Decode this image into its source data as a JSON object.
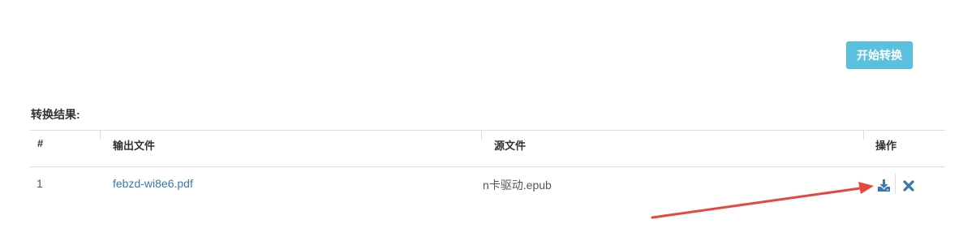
{
  "toolbar": {
    "convert_label": "开始转换"
  },
  "results": {
    "title": "转换结果:",
    "columns": {
      "index": "#",
      "output_file": "输出文件",
      "source_file": "源文件",
      "actions": "操作"
    },
    "rows": [
      {
        "index": "1",
        "output_file": "febzd-wi8e6.pdf",
        "source_file": "n卡驱动.epub",
        "actions": [
          "download-icon",
          "close-icon"
        ]
      }
    ]
  },
  "colors": {
    "accent_button": "#5bc0de",
    "link": "#337ab7",
    "icon": "#3a78b0",
    "annotation_arrow": "#e8483c"
  }
}
